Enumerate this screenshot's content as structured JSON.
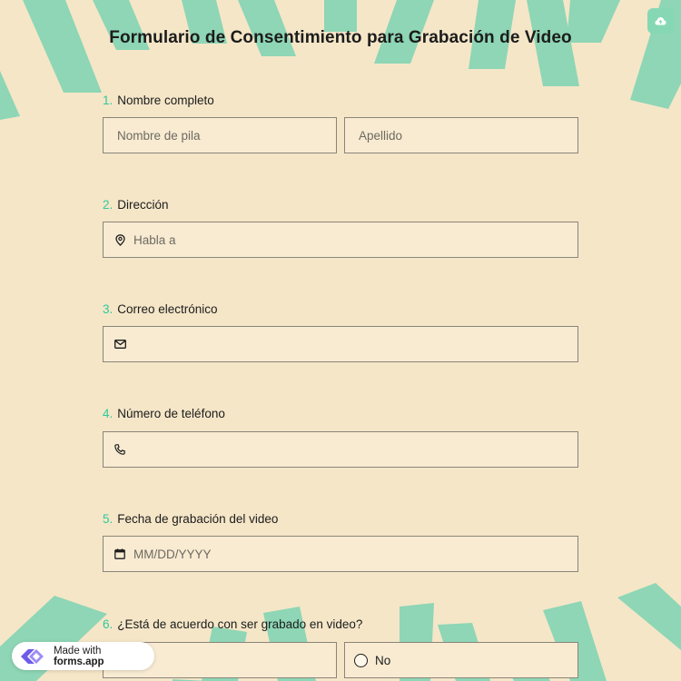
{
  "form": {
    "title": "Formulario de Consentimiento para Grabación de Video"
  },
  "questions": [
    {
      "number": "1.",
      "label": "Nombre completo",
      "fields": {
        "first_placeholder": "Nombre de pila",
        "last_placeholder": "Apellido"
      }
    },
    {
      "number": "2.",
      "label": "Dirección",
      "placeholder": "Habla a",
      "icon": "map-pin-icon"
    },
    {
      "number": "3.",
      "label": "Correo electrónico",
      "placeholder": "",
      "icon": "envelope-icon"
    },
    {
      "number": "4.",
      "label": "Número de teléfono",
      "placeholder": "",
      "icon": "phone-icon"
    },
    {
      "number": "5.",
      "label": "Fecha de grabación del video",
      "placeholder": "MM/DD/YYYY",
      "icon": "calendar-icon"
    },
    {
      "number": "6.",
      "label": "¿Está de acuerdo con ser grabado en video?",
      "options": [
        "",
        "No"
      ]
    }
  ],
  "badge": {
    "prefix": "Made with",
    "brand": "forms.app"
  },
  "colors": {
    "background": "#f5e6c8",
    "stripe": "#8ed6b5",
    "accent": "#2ec99a",
    "field": "#f8ebd2"
  },
  "icons": {
    "cloud": "cloud-upload-icon",
    "logo": "forms-app-logo-icon"
  }
}
